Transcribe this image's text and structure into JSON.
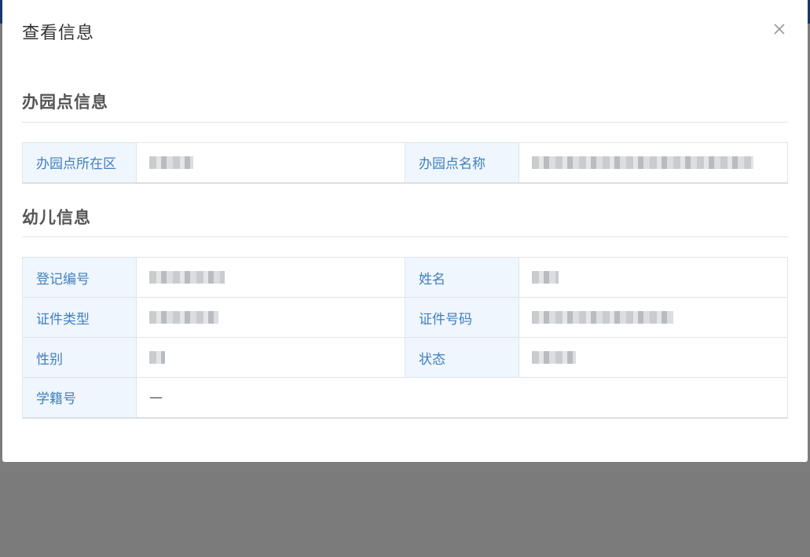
{
  "modal": {
    "title": "查看信息",
    "close_icon": "close-icon"
  },
  "sections": [
    {
      "title": "办园点信息",
      "rows": [
        [
          {
            "label": "办园点所在区",
            "value": ""
          },
          {
            "label": "办园点名称",
            "value": ""
          }
        ]
      ]
    },
    {
      "title": "幼儿信息",
      "rows": [
        [
          {
            "label": "登记编号",
            "value": ""
          },
          {
            "label": "姓名",
            "value": ""
          }
        ],
        [
          {
            "label": "证件类型",
            "value": ""
          },
          {
            "label": "证件号码",
            "value": ""
          }
        ],
        [
          {
            "label": "性别",
            "value": ""
          },
          {
            "label": "状态",
            "value": ""
          }
        ],
        [
          {
            "label": "学籍号",
            "value": "—"
          }
        ]
      ]
    }
  ],
  "colors": {
    "label_bg": "#f0f6fd",
    "label_text": "#3f7fc1",
    "overlay": "#7b7b7c"
  }
}
